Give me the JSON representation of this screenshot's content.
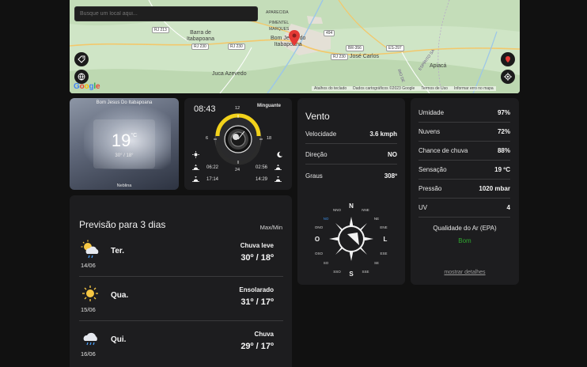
{
  "map": {
    "search_placeholder": "Busque um local aqui...",
    "labels": {
      "barra": "Barra de\nItabapoana",
      "bom_jesus": "Bom Jesus do\nItabapoana",
      "jose_carlos": "José Carlos",
      "juca": "Juca Azevedo",
      "aparecida": "APARECIDA",
      "pimentel": "PIMENTEL\nMARQUES",
      "apiaca": "Apiacá",
      "espirito": "ESPÍRITO SA",
      "rio_de": "RIO DE"
    },
    "roads": [
      "RJ 213",
      "RJ 230",
      "RJ 230",
      "BR-356",
      "494",
      "RJ 230",
      "ES-297"
    ],
    "footer": [
      "Atalhos do teclado",
      "Dados cartográficos ©2023 Google",
      "Termos de Uso",
      "Informar erro no mapa"
    ],
    "google_letters": [
      "G",
      "o",
      "o",
      "g",
      "l",
      "e"
    ],
    "google_colors": [
      "#4285F4",
      "#EA4335",
      "#FBBC05",
      "#4285F4",
      "#34A853",
      "#EA4335"
    ]
  },
  "current": {
    "city": "Bom Jesus Do Itabapoana",
    "temp": "19",
    "unit": "°C",
    "minmax": "30° / 18°",
    "condition": "Neblina"
  },
  "clock": {
    "time": "08:43",
    "moon_phase": "Minguante",
    "hours": {
      "h12": "12",
      "h6": "6",
      "h18": "18",
      "h24": "24"
    },
    "sunrise": "06:22",
    "sunset": "17:14",
    "moonrise": "02:56",
    "moonset": "14:29"
  },
  "wind": {
    "title": "Vento",
    "rows": [
      {
        "label": "Velocidade",
        "value": "3.6 kmph"
      },
      {
        "label": "Direção",
        "value": "NO"
      },
      {
        "label": "Graus",
        "value": "308º"
      }
    ],
    "compass": {
      "N": "N",
      "NNE": "NNE",
      "NE": "NE",
      "ENE": "ENE",
      "L": "L",
      "ESE": "ESE",
      "SE": "SE",
      "SSE": "SSE",
      "S": "S",
      "SSO": "SSO",
      "SO": "SO",
      "OSO": "OSO",
      "O": "O",
      "ONO": "ONO",
      "NO": "NO",
      "NNO": "NNO",
      "active": "NO",
      "active_color": "#3b8fe8"
    }
  },
  "stats": {
    "rows": [
      {
        "label": "Umidade",
        "value": "97%"
      },
      {
        "label": "Nuvens",
        "value": "72%"
      },
      {
        "label": "Chance de chuva",
        "value": "88%"
      },
      {
        "label": "Sensação",
        "value": "19 ºC"
      },
      {
        "label": "Pressão",
        "value": "1020 mbar"
      },
      {
        "label": "UV",
        "value": "4"
      }
    ],
    "air_quality_label": "Qualidade do Ar (EPA)",
    "air_quality_value": "Bom",
    "air_quality_color": "#2fa82f",
    "details_link": "mostrar detalhes"
  },
  "forecast": {
    "title": "Previsão para 3 dias",
    "minmax_label": "Max/Min",
    "days": [
      {
        "icon": "partly-cloudy-rain-icon",
        "date": "14/06",
        "day": "Ter.",
        "desc": "Chuva leve",
        "temps": "30º / 18º"
      },
      {
        "icon": "sun-icon",
        "date": "15/06",
        "day": "Qua.",
        "desc": "Ensolarado",
        "temps": "31º / 17º"
      },
      {
        "icon": "cloud-rain-icon",
        "date": "16/06",
        "day": "Qui.",
        "desc": "Chuva",
        "temps": "29º / 17º"
      }
    ]
  }
}
